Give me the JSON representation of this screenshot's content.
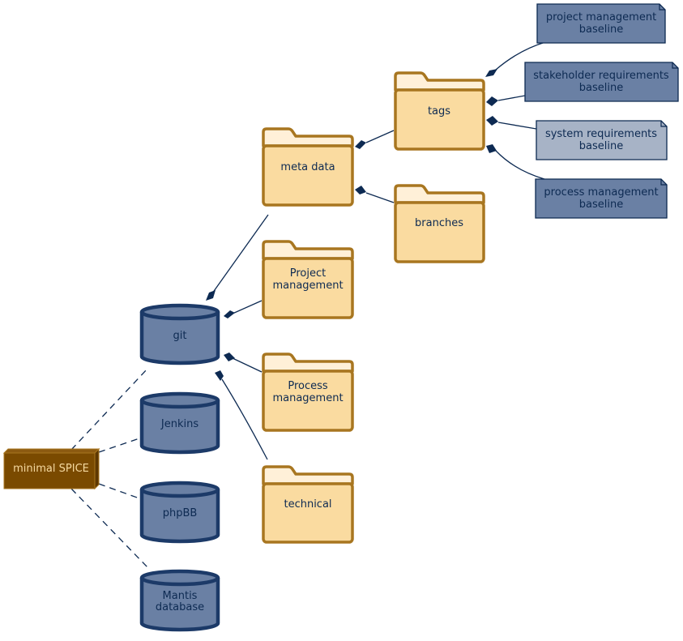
{
  "diagram": {
    "node": {
      "label": "minimal SPICE",
      "fill": "#7a4a00",
      "text_color": "#f5d9a0"
    },
    "databases": [
      {
        "id": "git",
        "label": [
          "git"
        ]
      },
      {
        "id": "jenkins",
        "label": [
          "Jenkins"
        ]
      },
      {
        "id": "phpbb",
        "label": [
          "phpBB"
        ]
      },
      {
        "id": "mantis",
        "label": [
          "Mantis",
          "database"
        ]
      }
    ],
    "folders": [
      {
        "id": "meta-data",
        "label": [
          "meta data"
        ]
      },
      {
        "id": "project-management",
        "label": [
          "Project",
          "management"
        ]
      },
      {
        "id": "process-management",
        "label": [
          "Process",
          "management"
        ]
      },
      {
        "id": "technical",
        "label": [
          "technical"
        ]
      },
      {
        "id": "tags",
        "label": [
          "tags"
        ]
      },
      {
        "id": "branches",
        "label": [
          "branches"
        ]
      }
    ],
    "notes": [
      {
        "id": "project-management-baseline",
        "label": [
          "project management",
          "baseline"
        ],
        "fill": "#6a80a4"
      },
      {
        "id": "stakeholder-requirements-baseline",
        "label": [
          "stakeholder requirements",
          "baseline"
        ],
        "fill": "#6a80a4"
      },
      {
        "id": "system-requirements-baseline",
        "label": [
          "system requirements",
          "baseline"
        ],
        "fill": "#a7b3c6"
      },
      {
        "id": "process-management-baseline",
        "label": [
          "process management",
          "baseline"
        ],
        "fill": "#6a80a4"
      }
    ],
    "dependencies": [
      {
        "from": "minimal SPICE",
        "to": "git"
      },
      {
        "from": "minimal SPICE",
        "to": "Jenkins"
      },
      {
        "from": "minimal SPICE",
        "to": "phpBB"
      },
      {
        "from": "minimal SPICE",
        "to": "Mantis database"
      }
    ],
    "compositions": [
      {
        "whole": "git",
        "part": "meta data"
      },
      {
        "whole": "git",
        "part": "Project management"
      },
      {
        "whole": "git",
        "part": "Process management"
      },
      {
        "whole": "git",
        "part": "technical"
      },
      {
        "whole": "meta data",
        "part": "tags"
      },
      {
        "whole": "meta data",
        "part": "branches"
      },
      {
        "whole": "tags",
        "part": "project management baseline"
      },
      {
        "whole": "tags",
        "part": "stakeholder requirements baseline"
      },
      {
        "whole": "tags",
        "part": "system requirements baseline"
      },
      {
        "whole": "tags",
        "part": "process management baseline"
      }
    ]
  }
}
